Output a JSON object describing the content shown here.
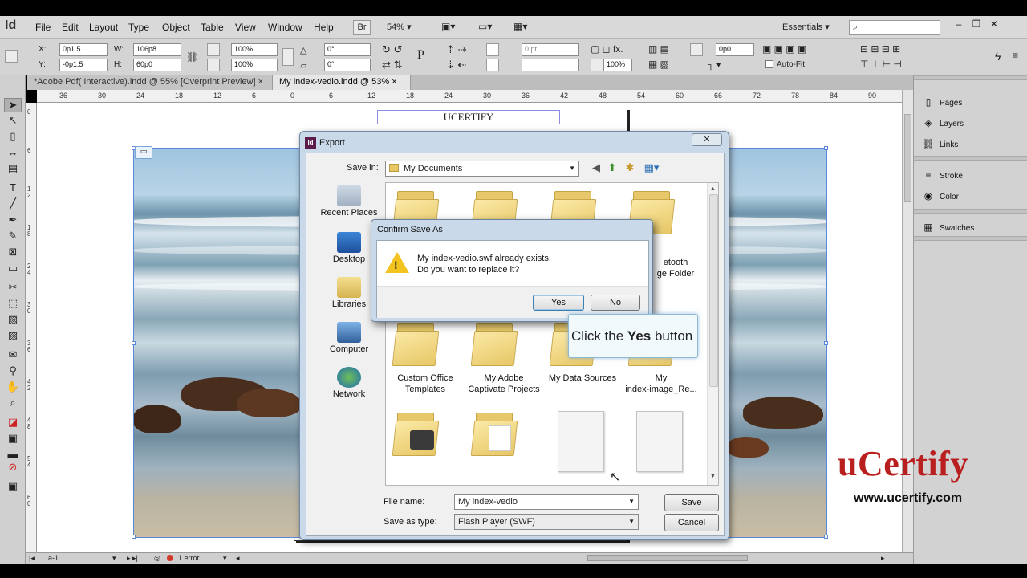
{
  "app": {
    "logo": "Id"
  },
  "menubar": {
    "items": [
      "File",
      "Edit",
      "Layout",
      "Type",
      "Object",
      "Table",
      "View",
      "Window",
      "Help"
    ],
    "bridge_label": "Br",
    "zoom": "54%",
    "workspace": "Essentials",
    "search_placeholder": ""
  },
  "controlbar": {
    "x_label": "X:",
    "x_value": "0p1.5",
    "y_label": "Y:",
    "y_value": "-0p1.5",
    "w_label": "W:",
    "w_value": "106p8",
    "h_label": "H:",
    "h_value": "60p0",
    "scale_x": "100%",
    "scale_y": "100%",
    "rotate": "0°",
    "shear": "0°",
    "stroke_weight": "0 pt",
    "opacity": "100%",
    "fit_value": "0p0",
    "autofit_label": "Auto-Fit"
  },
  "tabs": [
    {
      "label": "*Adobe Pdf( Interactive).indd @ 55% [Overprint Preview]",
      "close": "×"
    },
    {
      "label": "My index-vedio.indd @ 53%",
      "close": "×"
    }
  ],
  "ruler": {
    "h_ticks": [
      "36",
      "30",
      "24",
      "18",
      "12",
      "6",
      "0",
      "6",
      "12",
      "18",
      "24",
      "30",
      "36",
      "42",
      "48",
      "54",
      "60",
      "66",
      "72",
      "78",
      "84",
      "90"
    ],
    "v_ticks": [
      "0",
      "6",
      "1 2",
      "1 8",
      "2 4",
      "3 0",
      "3 6",
      "4 2",
      "4 8",
      "5 4",
      "6 0"
    ]
  },
  "document": {
    "page_title": "UCERTIFY"
  },
  "right_panel": {
    "items": [
      "Pages",
      "Layers",
      "Links",
      "Stroke",
      "Color",
      "Swatches"
    ],
    "icons": [
      "pages-icon",
      "layers-icon",
      "links-icon",
      "stroke-icon",
      "color-icon",
      "swatches-icon"
    ]
  },
  "statusbar": {
    "page": "a-1",
    "errors": "1 error"
  },
  "export_dialog": {
    "title": "Export",
    "close": "✕",
    "save_in_label": "Save in:",
    "save_in_value": "My Documents",
    "places": [
      "Recent Places",
      "Desktop",
      "Libraries",
      "Computer",
      "Network"
    ],
    "files": [
      {
        "name": "",
        "kind": "folder"
      },
      {
        "name": "",
        "kind": "folder"
      },
      {
        "name": "",
        "kind": "folder"
      },
      {
        "name": "etooth\nge Folder",
        "kind": "folder"
      },
      {
        "name": "Custom Office\nTemplates",
        "kind": "folder"
      },
      {
        "name": "My Adobe\nCaptivate Projects",
        "kind": "folder"
      },
      {
        "name": "My Data Sources",
        "kind": "folder"
      },
      {
        "name": "My\nindex-image_Re...",
        "kind": "folder"
      },
      {
        "name": "",
        "kind": "folder"
      },
      {
        "name": "",
        "kind": "folder"
      },
      {
        "name": "",
        "kind": "file"
      },
      {
        "name": "",
        "kind": "file"
      }
    ],
    "filename_label": "File name:",
    "filename_value": "My index-vedio",
    "type_label": "Save as type:",
    "type_value": "Flash Player (SWF)",
    "save_button": "Save",
    "cancel_button": "Cancel"
  },
  "confirm_dialog": {
    "title": "Confirm Save As",
    "line1": "My index-vedio.swf already exists.",
    "line2": "Do you want to replace it?",
    "yes": "Yes",
    "no": "No"
  },
  "callout": {
    "prefix": "Click the ",
    "bold": "Yes",
    "suffix": " button"
  },
  "watermark": {
    "logo": "uCertify",
    "url": "www.ucertify.com"
  },
  "colors": {
    "accent_red": "#b91f1f",
    "dialog_chrome": "#c9d9ea",
    "warning": "#f3c320"
  }
}
